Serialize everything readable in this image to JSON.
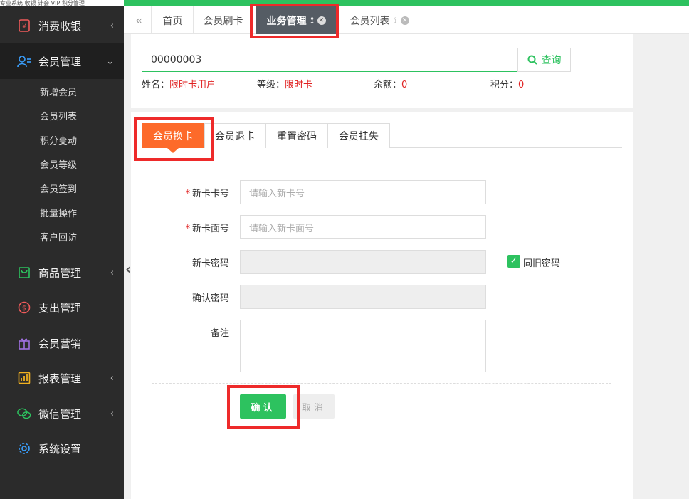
{
  "top_strip_text": "专业系统  收银 计会  VIP 积分管理",
  "sidebar": {
    "items": [
      {
        "label": "消费收银",
        "icon": "cashier-icon",
        "arrow": "‹"
      },
      {
        "label": "会员管理",
        "icon": "member-icon",
        "arrow": "⌄"
      },
      {
        "label": "商品管理",
        "icon": "goods-icon",
        "arrow": "‹"
      },
      {
        "label": "支出管理",
        "icon": "expense-icon",
        "arrow": ""
      },
      {
        "label": "会员营销",
        "icon": "gift-icon",
        "arrow": ""
      },
      {
        "label": "报表管理",
        "icon": "report-icon",
        "arrow": "‹"
      },
      {
        "label": "微信管理",
        "icon": "wechat-icon",
        "arrow": "‹"
      },
      {
        "label": "系统设置",
        "icon": "settings-icon",
        "arrow": ""
      }
    ],
    "subitems": [
      "新增会员",
      "会员列表",
      "积分变动",
      "会员等级",
      "会员签到",
      "批量操作",
      "客户回访"
    ]
  },
  "tabs": {
    "collapse": "«",
    "items": [
      {
        "label": "首页"
      },
      {
        "label": "会员刷卡"
      },
      {
        "label": "业务管理"
      },
      {
        "label": "会员列表"
      }
    ]
  },
  "search": {
    "value": "00000003",
    "button_label": "查询"
  },
  "info": {
    "name_label": "姓名：",
    "name_value": "限时卡用户",
    "level_label": "等级：",
    "level_value": "限时卡",
    "balance_label": "余额：",
    "balance_value": "0",
    "points_label": "积分：",
    "points_value": "0"
  },
  "subtabs": [
    "会员换卡",
    "会员退卡",
    "重置密码",
    "会员挂失"
  ],
  "form": {
    "new_card_no_label": "新卡卡号",
    "new_card_no_placeholder": "请输入新卡号",
    "new_card_face_label": "新卡面号",
    "new_card_face_placeholder": "请输入新卡面号",
    "new_pwd_label": "新卡密码",
    "confirm_pwd_label": "确认密码",
    "same_pwd_label": "同旧密码",
    "remark_label": "备注",
    "confirm_button": "确认",
    "cancel_button": "取消"
  },
  "colors": {
    "accent_green": "#2dc25f",
    "accent_orange": "#fd6a2a",
    "highlight_red": "#ee2a2a",
    "sidebar_bg": "#2b2b2b"
  }
}
